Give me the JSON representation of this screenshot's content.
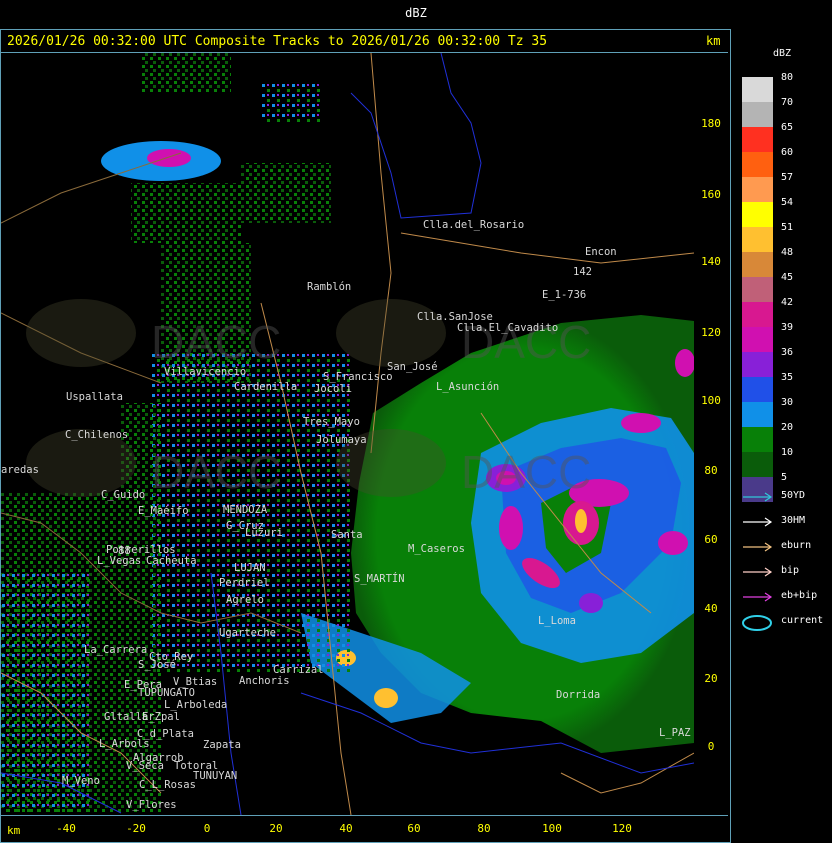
{
  "header": {
    "field_label": "dBZ"
  },
  "title": "2026/01/26 00:32:00 UTC Composite Tracks to 2026/01/26 00:32:00 Tz 35",
  "axis_unit": "km",
  "y_ticks": [
    "180",
    "160",
    "140",
    "120",
    "100",
    "80",
    "60",
    "40",
    "20",
    "0"
  ],
  "x_ticks": [
    "-40",
    "-20",
    "0",
    "20",
    "40",
    "60",
    "80",
    "100",
    "120"
  ],
  "legend": {
    "title": "dBZ",
    "levels": [
      {
        "value": "80",
        "color": "#d9d9d9"
      },
      {
        "value": "70",
        "color": "#b4b4b4"
      },
      {
        "value": "65",
        "color": "#ff3020"
      },
      {
        "value": "60",
        "color": "#ff6010"
      },
      {
        "value": "57",
        "color": "#ff9a50"
      },
      {
        "value": "54",
        "color": "#ffff00"
      },
      {
        "value": "51",
        "color": "#ffc030"
      },
      {
        "value": "48",
        "color": "#d88838"
      },
      {
        "value": "45",
        "color": "#c06078"
      },
      {
        "value": "42",
        "color": "#d81890"
      },
      {
        "value": "39",
        "color": "#d010b0"
      },
      {
        "value": "36",
        "color": "#8820d8"
      },
      {
        "value": "35",
        "color": "#2050e8"
      },
      {
        "value": "30",
        "color": "#1090e8"
      },
      {
        "value": "20",
        "color": "#088008"
      },
      {
        "value": "10",
        "color": "#0a5c0a"
      },
      {
        "value": "5",
        "color": "#4a3a8a"
      }
    ],
    "tracks": [
      {
        "label": "50YD",
        "color": "#30c8d8"
      },
      {
        "label": "30HM",
        "color": "#ffffff"
      },
      {
        "label": "eburn",
        "color": "#f0c080"
      },
      {
        "label": "bip",
        "color": "#ffd0c8"
      },
      {
        "label": "eb+bip",
        "color": "#e040e0"
      },
      {
        "label": "current",
        "color": "#30d0e8"
      }
    ]
  },
  "places": [
    {
      "name": "Clla.del_Rosario"
    },
    {
      "name": "Encon"
    },
    {
      "name": "Ramblón"
    },
    {
      "name": "E_1-736"
    },
    {
      "name": "Clla.SanJose"
    },
    {
      "name": "Clla.El_Cavadito"
    },
    {
      "name": "Villavicencio"
    },
    {
      "name": "Uspallata"
    },
    {
      "name": "Cardenilla"
    },
    {
      "name": "S_Francisco"
    },
    {
      "name": "Jocoli"
    },
    {
      "name": "San_José"
    },
    {
      "name": "L_Asunción"
    },
    {
      "name": "C_Chilenos"
    },
    {
      "name": "Tres_Mayo"
    },
    {
      "name": "Jolumaya"
    },
    {
      "name": "aredas"
    },
    {
      "name": "C_Guido"
    },
    {
      "name": "E_Maéifo"
    },
    {
      "name": "MENDOZA"
    },
    {
      "name": "G_Cruz"
    },
    {
      "name": "Luzuri"
    },
    {
      "name": "Potrerillos"
    },
    {
      "name": "L_Vegas"
    },
    {
      "name": "Cacheuta"
    },
    {
      "name": "LUJAN"
    },
    {
      "name": "Perdriel"
    },
    {
      "name": "Agrelo"
    },
    {
      "name": "S_MARTÍN"
    },
    {
      "name": "M_Caseros"
    },
    {
      "name": "Ugarteche"
    },
    {
      "name": "La_Carrera"
    },
    {
      "name": "Cto_Rey"
    },
    {
      "name": "S_José"
    },
    {
      "name": "E_Pera"
    },
    {
      "name": "V_Btias"
    },
    {
      "name": "TUPUNGATO"
    },
    {
      "name": "Anchoris"
    },
    {
      "name": "Carrizal"
    },
    {
      "name": "L_Arboleda"
    },
    {
      "name": "Gltallar"
    },
    {
      "name": "E_Zpal"
    },
    {
      "name": "C_d_Plata"
    },
    {
      "name": "L_Arbols"
    },
    {
      "name": "Zapata"
    },
    {
      "name": "Algarrob"
    },
    {
      "name": "V_Seca"
    },
    {
      "name": "Totoral"
    },
    {
      "name": "TUNUYAN"
    },
    {
      "name": "C_L_Rosas"
    },
    {
      "name": "V_Flores"
    },
    {
      "name": "M_Veno"
    },
    {
      "name": "Dorrida"
    },
    {
      "name": "L_PAZ"
    },
    {
      "name": "L_Loma"
    },
    {
      "name": "Santa"
    },
    {
      "name": "142"
    },
    {
      "name": "88"
    }
  ],
  "watermark": "DACC"
}
